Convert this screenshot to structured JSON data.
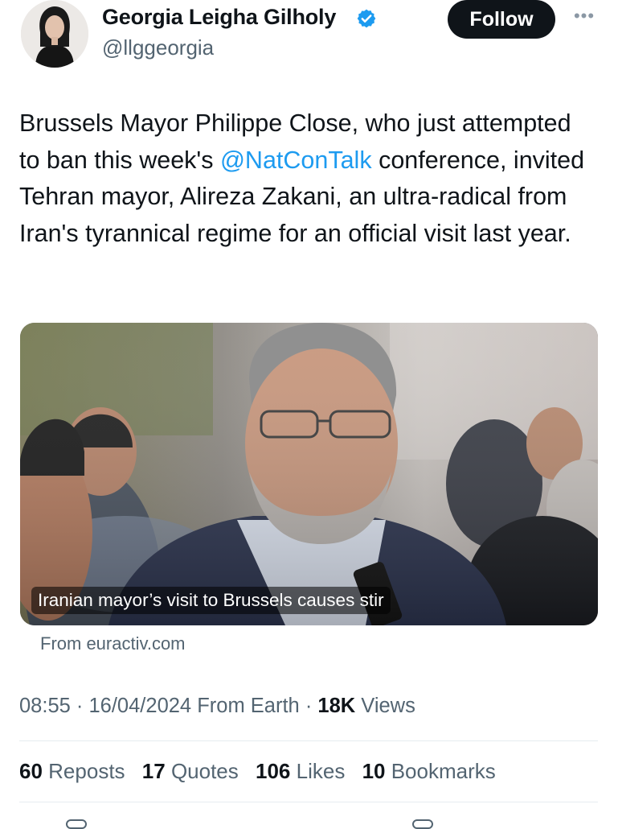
{
  "author": {
    "display_name": "Georgia Leigha Gilholy",
    "handle": "@llggeorgia",
    "verified": true
  },
  "actions": {
    "follow_label": "Follow",
    "more_label": "•••"
  },
  "tweet": {
    "text_before": "Brussels Mayor Philippe Close, who just attempted to ban this week's ",
    "mention": "@NatConTalk",
    "text_after": " conference, invited Tehran mayor, Alireza Zakani, an ultra-radical from Iran's tyrannical regime for an official visit last year."
  },
  "card": {
    "title": "Iranian mayor’s visit to Brussels causes stir",
    "source": "From euractiv.com"
  },
  "meta": {
    "time": "08:55",
    "date": "16/04/2024",
    "location": "From Earth",
    "views_count": "18K",
    "views_label": "Views"
  },
  "stats": [
    {
      "count": "60",
      "label": "Reposts"
    },
    {
      "count": "17",
      "label": "Quotes"
    },
    {
      "count": "106",
      "label": "Likes"
    },
    {
      "count": "10",
      "label": "Bookmarks"
    }
  ],
  "colors": {
    "link": "#1d9bf0",
    "verified": "#1d9bf0",
    "secondary_text": "#536471",
    "primary_text": "#0f1419"
  },
  "icons": [
    "verified-badge-icon",
    "more-icon",
    "reply-icon",
    "bookmark-icon"
  ]
}
